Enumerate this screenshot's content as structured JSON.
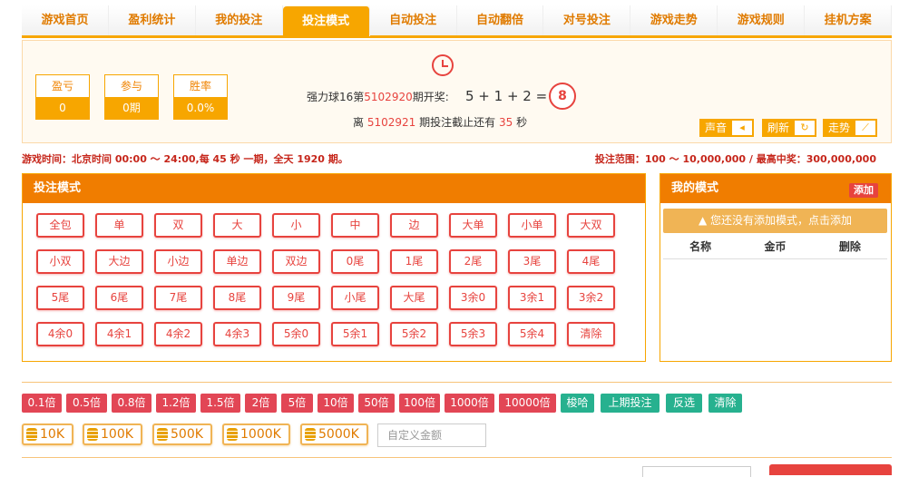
{
  "nav": {
    "items": [
      {
        "label": "游戏首页"
      },
      {
        "label": "盈利统计"
      },
      {
        "label": "我的投注"
      },
      {
        "label": "投注模式"
      },
      {
        "label": "自动投注"
      },
      {
        "label": "自动翻倍"
      },
      {
        "label": "对号投注"
      },
      {
        "label": "游戏走势"
      },
      {
        "label": "游戏规则"
      },
      {
        "label": "挂机方案"
      }
    ],
    "active_index": 3
  },
  "stats": [
    {
      "title": "盈亏",
      "value": "0"
    },
    {
      "title": "参与",
      "value": "0期"
    },
    {
      "title": "胜率",
      "value": "0.0%"
    }
  ],
  "draw": {
    "prefix": "强力球16第",
    "period": "5102920",
    "suffix": "期开奖:",
    "formula": "5 + 1 + 2 =",
    "result": "8",
    "countdown_prefix": "离",
    "next_period": "5102921",
    "countdown_mid": "期投注截止还有",
    "seconds": "35",
    "countdown_suffix": "秒"
  },
  "tools": {
    "sound": "声音",
    "refresh": "刷新",
    "trend": "走势"
  },
  "info": {
    "left": "游戏时间：北京时间 00:00 ～ 24:00,每 45 秒 一期，全天 1920 期。",
    "right": "投注范围：100 ～ 10,000,000 / 最高中奖：300,000,000"
  },
  "mode_panel": {
    "title": "投注模式",
    "buttons": [
      "全包",
      "单",
      "双",
      "大",
      "小",
      "中",
      "边",
      "大单",
      "小单",
      "大双",
      "小双",
      "大边",
      "小边",
      "单边",
      "双边",
      "0尾",
      "1尾",
      "2尾",
      "3尾",
      "4尾",
      "5尾",
      "6尾",
      "7尾",
      "8尾",
      "9尾",
      "小尾",
      "大尾",
      "3余0",
      "3余1",
      "3余2",
      "4余0",
      "4余1",
      "4余2",
      "4余3",
      "5余0",
      "5余1",
      "5余2",
      "5余3",
      "5余4",
      "清除"
    ]
  },
  "my_panel": {
    "title": "我的模式",
    "add_label": "添加",
    "warning": "您还没有添加模式，点击添加",
    "columns": [
      "名称",
      "金币",
      "删除"
    ]
  },
  "multipliers": [
    "0.1倍",
    "0.5倍",
    "0.8倍",
    "1.2倍",
    "1.5倍",
    "2倍",
    "5倍",
    "10倍",
    "50倍",
    "100倍",
    "1000倍",
    "10000倍"
  ],
  "actions": [
    "梭哈",
    "上期投注",
    "反选",
    "清除"
  ],
  "coins": [
    "10K",
    "100K",
    "500K",
    "1000K",
    "5000K"
  ],
  "custom_amount": {
    "placeholder": "自定义金额"
  },
  "colors": {
    "accent": "#f7a600",
    "header_orange": "#f07d00",
    "red": "#e7433e",
    "multiplier_red": "#e24655",
    "action_green": "#27b18f"
  }
}
